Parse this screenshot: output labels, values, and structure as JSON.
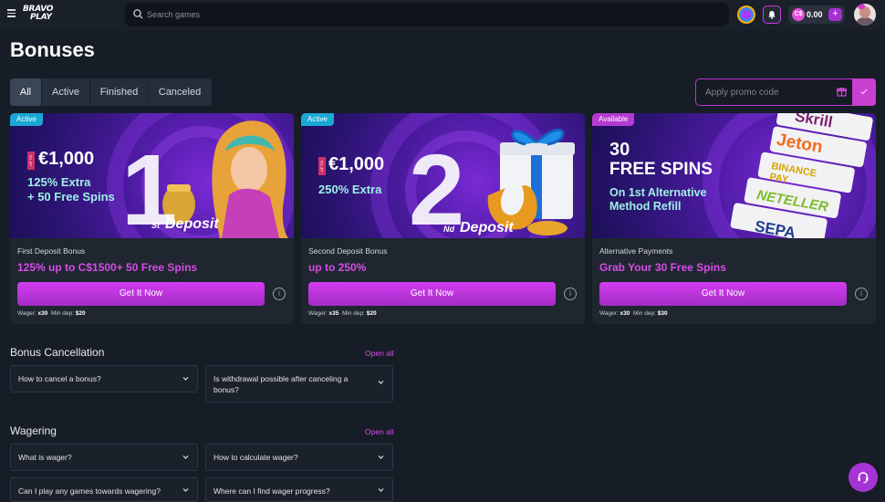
{
  "header": {
    "logo_top": "BRAVO",
    "logo_bottom": "PLAY",
    "search_placeholder": "Search games",
    "balance": "0.00",
    "currency_badge": "C$"
  },
  "page": {
    "title": "Bonuses"
  },
  "tabs": [
    {
      "label": "All"
    },
    {
      "label": "Active"
    },
    {
      "label": "Finished"
    },
    {
      "label": "Canceled"
    }
  ],
  "promo": {
    "placeholder": "Apply promo code"
  },
  "cards": [
    {
      "badge": "Active",
      "banner": {
        "upto": "UP TO",
        "amount": "€1,000",
        "line1": "125% Extra",
        "line2": "+ 50 Free Spins",
        "big": "1",
        "deposit_prefix": "St",
        "deposit": "Deposit"
      },
      "subtitle": "First Deposit Bonus",
      "headline": "125% up to C$1500+ 50 Free Spins",
      "cta": "Get It Now",
      "wager_label": "Wager:",
      "wager": "x30",
      "min_label": "Min dep:",
      "min": "$20"
    },
    {
      "badge": "Active",
      "banner": {
        "upto": "UP TO",
        "amount": "€1,000",
        "line1": "250% Extra",
        "big": "2",
        "deposit_prefix": "Nd",
        "deposit": "Deposit"
      },
      "subtitle": "Second Deposit Bonus",
      "headline": "up to 250%",
      "cta": "Get It Now",
      "wager_label": "Wager:",
      "wager": "x35",
      "min_label": "Min dep:",
      "min": "$20"
    },
    {
      "badge": "Available",
      "banner": {
        "line1": "30",
        "line2": "FREE SPINS",
        "line3": "On 1st Alternative",
        "line4": "Method Refill",
        "brands": [
          "Skrill",
          "Jeton",
          "BINANCE PAY",
          "NETELLER",
          "SEPA"
        ]
      },
      "subtitle": "Alternative Payments",
      "headline": "Grab Your 30 Free Spins",
      "cta": "Get It Now",
      "wager_label": "Wager:",
      "wager": "x30",
      "min_label": "Min dep:",
      "min": "$30"
    }
  ],
  "faq_sections": [
    {
      "title": "Bonus Cancellation",
      "open_all": "Open all",
      "items": [
        "How to cancel a bonus?",
        "Is withdrawal possible after canceling a bonus?"
      ]
    },
    {
      "title": "Wagering",
      "open_all": "Open all",
      "items": [
        "What is wager?",
        "How to calculate wager?",
        "Can I play any games towards wagering?",
        "Where can I find wager progress?"
      ]
    }
  ],
  "colors": {
    "accent": "#c93fcf",
    "active_badge": "#1aa7d6",
    "background": "#171d27"
  }
}
